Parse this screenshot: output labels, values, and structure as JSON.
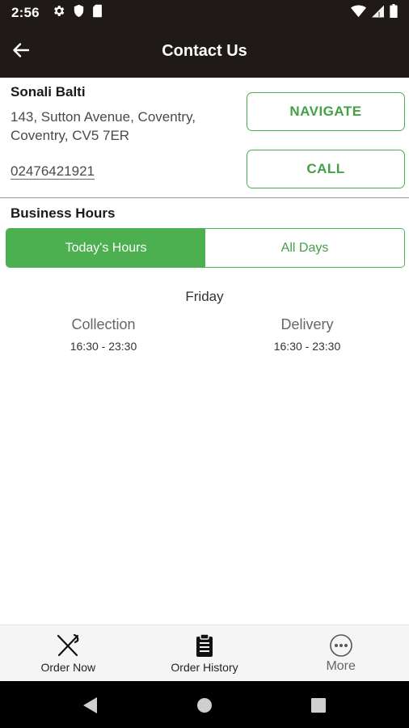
{
  "status_bar": {
    "time": "2:56",
    "left_icons": [
      "settings-icon",
      "shield-icon",
      "sim-card-icon"
    ],
    "right_icons": [
      "wifi-icon",
      "cellular-signal-icon",
      "battery-icon"
    ]
  },
  "header": {
    "title": "Contact Us",
    "back_icon": "arrow-left-icon"
  },
  "store": {
    "name": "Sonali Balti",
    "address_line1": "143, Sutton Avenue, Coventry,",
    "address_line2": "Coventry, CV5 7ER",
    "phone": "02476421921"
  },
  "actions": {
    "navigate_label": "NAVIGATE",
    "call_label": "CALL"
  },
  "business_hours": {
    "title": "Business Hours",
    "tabs": [
      {
        "label": "Today's Hours",
        "active": true
      },
      {
        "label": "All Days",
        "active": false
      }
    ],
    "day": "Friday",
    "collection": {
      "label": "Collection",
      "hours": "16:30 - 23:30"
    },
    "delivery": {
      "label": "Delivery",
      "hours": "16:30 - 23:30"
    }
  },
  "bottom_nav": {
    "items": [
      {
        "label": "Order Now",
        "icon": "fork-knife-icon"
      },
      {
        "label": "Order History",
        "icon": "clipboard-icon"
      },
      {
        "label": "More",
        "icon": "more-dots-icon"
      }
    ]
  },
  "system_nav": [
    "back-triangle-icon",
    "home-circle-icon",
    "recents-square-icon"
  ],
  "colors": {
    "header_bg": "#1f1a17",
    "accent_green": "#4caf50",
    "bottom_nav_bg": "#f5f5f5"
  }
}
